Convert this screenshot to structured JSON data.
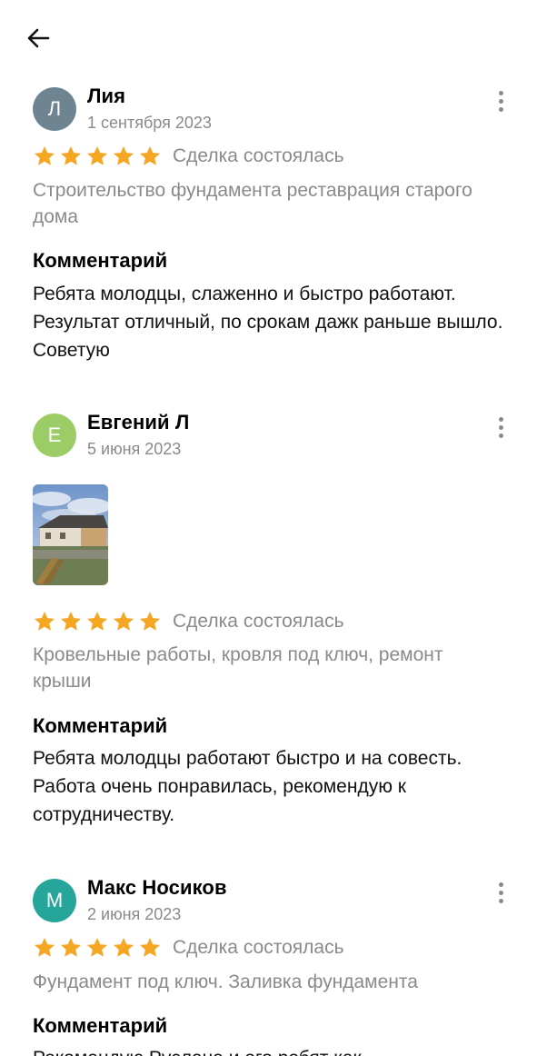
{
  "colors": {
    "star": "#F5A623",
    "muted": "#8a8a8a",
    "avatar_gray": "#6f8491",
    "avatar_green": "#9ccc65",
    "avatar_teal": "#26a69a"
  },
  "header": {
    "back_icon": "arrow-left-icon"
  },
  "reviews": [
    {
      "avatar_letter": "Л",
      "name": "Лия",
      "date": "1 сентября 2023",
      "stars": 5,
      "deal": "Сделка состоялась",
      "service": "Строительство фундамента реставрация старого дома",
      "comment_title": "Комментарий",
      "comment": "Ребята молодцы, слаженно и быстро работают.\nРезультат отличный, по срокам  дажк раньше вышло. Советую"
    },
    {
      "avatar_letter": "Е",
      "name": "Евгений Л",
      "date": "5 июня 2023",
      "has_photo": true,
      "stars": 5,
      "deal": "Сделка состоялась",
      "service": "Кровельные работы, кровля под ключ, ремонт крыши",
      "comment_title": "Комментарий",
      "comment": "Ребята молодцы работают быстро и на совесть. Работа очень понравилась, рекомендую к сотрудничеству."
    },
    {
      "avatar_letter": "М",
      "name": "Макс Носиков",
      "date": "2 июня 2023",
      "stars": 5,
      "deal": "Сделка состоялась",
      "service": "Фундамент под ключ. Заливка фундамента",
      "comment_title": "Комментарий",
      "comment": "Рекомендую Руслана и его ребят как"
    }
  ]
}
